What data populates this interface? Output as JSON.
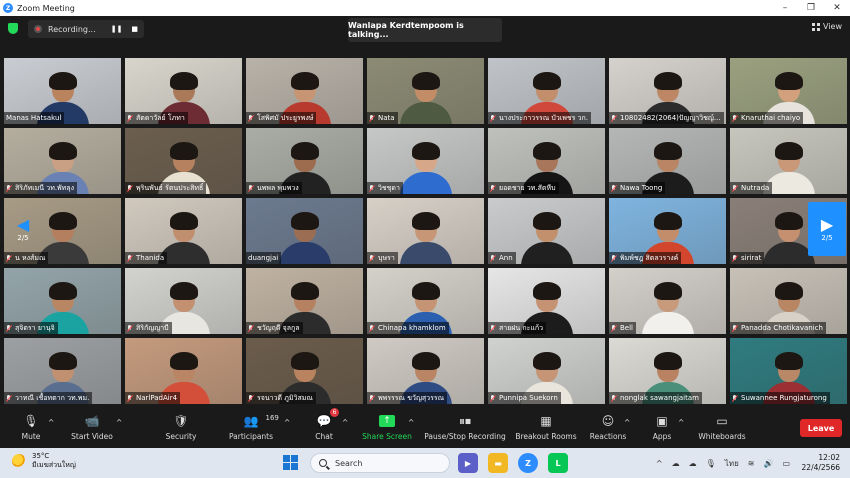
{
  "window": {
    "title": "Zoom Meeting",
    "controls": [
      "–",
      "❐",
      "✕"
    ]
  },
  "recording": {
    "label": "Recording...",
    "pause_icon": "pause-icon",
    "stop_icon": "stop-icon"
  },
  "talking_banner": "Wanlapa Kerdtempoom is talking...",
  "view": {
    "label": "View"
  },
  "pager": {
    "left_label": "2/5",
    "right_label": "2/5"
  },
  "participants": [
    {
      "name": "Manas Hatsakul",
      "muted": false,
      "bg": "#c9cdd2",
      "skin": "#b9835e",
      "shirt": "#233a66"
    },
    {
      "name": "สัตดาวัลย์ โภทา",
      "muted": true,
      "bg": "#d8d5cc",
      "skin": "#a9795a",
      "shirt": "#6d2b33"
    },
    {
      "name": "โสพิศมั ประยูรพงษ์",
      "muted": true,
      "bg": "#b8b2a8",
      "skin": "#c79574",
      "shirt": "#b83a2e"
    },
    {
      "name": "Nata",
      "muted": true,
      "bg": "#8c8b74",
      "skin": "#c28c67",
      "shirt": "#4f5a42"
    },
    {
      "name": "นางประกาวรรณ บัวเพชร วก.",
      "muted": true,
      "bg": "#c0c4c8",
      "skin": "#c38e6c",
      "shirt": "#d0473c"
    },
    {
      "name": "10802482(2064)ปัญญาวิชญ์...",
      "muted": true,
      "bg": "#d5d2cd",
      "skin": "#bd8766",
      "shirt": "#2c2c2c"
    },
    {
      "name": "Knaruthai chaiyo",
      "muted": true,
      "bg": "#9aa07f",
      "skin": "#d3a07d",
      "shirt": "#e7e2db"
    },
    {
      "name": "สิริภัทเมนี วท.พัทลุง",
      "muted": true,
      "bg": "#b5ae9f",
      "skin": "#caa085",
      "shirt": "#6a81b3"
    },
    {
      "name": "พุรินพันธ์ รัตนประสิทธิ์",
      "muted": true,
      "bg": "#6b5e4e",
      "skin": "#b5815f",
      "shirt": "#e8e0d0"
    },
    {
      "name": "นพพล พุมพวง",
      "muted": true,
      "bg": "#a9ada5",
      "skin": "#9d6b4d",
      "shirt": "#222222"
    },
    {
      "name": "วิชชุดา",
      "muted": true,
      "bg": "#c6c8c7",
      "skin": "#d6a789",
      "shirt": "#2f6ccf"
    },
    {
      "name": "ยอดชาย วท.สัตหีบ",
      "muted": true,
      "bg": "#bfc1bd",
      "skin": "#a8765a",
      "shirt": "#151515"
    },
    {
      "name": "Nawa Toong",
      "muted": true,
      "bg": "#b4b7b6",
      "skin": "#b98565",
      "shirt": "#1c1c1c"
    },
    {
      "name": "Nutrada",
      "muted": true,
      "bg": "#c7c6bd",
      "skin": "#c99878",
      "shirt": "#ece9e0"
    },
    {
      "name": "น หงส์มณ",
      "muted": true,
      "bg": "#a79b85",
      "skin": "#b47f5e",
      "shirt": "#3a3a3a"
    },
    {
      "name": "Thanida",
      "muted": true,
      "bg": "#d1c9be",
      "skin": "#c08f6f",
      "shirt": "#2e2e2e"
    },
    {
      "name": "duangjai",
      "muted": false,
      "bg": "#6c7a8f",
      "skin": "#9b6e54",
      "shirt": "#2a3c6a"
    },
    {
      "name": "บุษรา",
      "muted": true,
      "bg": "#d7d0c7",
      "skin": "#c79677",
      "shirt": "#3a4a6a"
    },
    {
      "name": "Ann",
      "muted": true,
      "bg": "#c9cbcc",
      "skin": "#c2906d",
      "shirt": "#202020"
    },
    {
      "name": "พิมพ์ชฎ สิตลวรางค์",
      "muted": true,
      "bg": "#7fb4df",
      "skin": "#c28d6b",
      "shirt": "#d3462e"
    },
    {
      "name": "sirirat",
      "muted": true,
      "bg": "#8a7f78",
      "skin": "#c4906f",
      "shirt": "#2c2c2c"
    },
    {
      "name": "สุจิตรา ยานุจิ",
      "muted": true,
      "bg": "#93a4a9",
      "skin": "#b98664",
      "shirt": "#1aa3a0"
    },
    {
      "name": "สิริกัญญาบี",
      "muted": true,
      "bg": "#d2d3cf",
      "skin": "#c39072",
      "shirt": "#e8e6e1"
    },
    {
      "name": "ชวัญฤดี จุลกูล",
      "muted": true,
      "bg": "#bfb2a2",
      "skin": "#b58161",
      "shirt": "#2c2c2c"
    },
    {
      "name": "Chinapa khamklom",
      "muted": true,
      "bg": "#d4d1c9",
      "skin": "#c59475",
      "shirt": "#2b5fb0"
    },
    {
      "name": "สายฝน กะแก้ว",
      "muted": true,
      "bg": "#e6e6e6",
      "skin": "#c59374",
      "shirt": "#1c1c1c"
    },
    {
      "name": "Bell",
      "muted": true,
      "bg": "#d3cfc9",
      "skin": "#c89a7c",
      "shirt": "#f2f0ec"
    },
    {
      "name": "Panadda Chotikavanich",
      "muted": true,
      "bg": "#c7c1b7",
      "skin": "#b98664",
      "shirt": "#d7d1c8"
    },
    {
      "name": "วาทณี เชื้อทตาก วท.พม.",
      "muted": true,
      "bg": "#9da0a3",
      "skin": "#c19070",
      "shirt": "#5a6f8f"
    },
    {
      "name": "NarlPadAir4",
      "muted": true,
      "bg": "#c49a7d",
      "skin": "#b98565",
      "shirt": "#d34f3a"
    },
    {
      "name": "รจนาวดี ภูมิวิสมณ",
      "muted": true,
      "bg": "#6b5c4b",
      "skin": "#b9835f",
      "shirt": "#2c2c2c"
    },
    {
      "name": "พพรรรณ ขวัญสุวรรณ",
      "muted": true,
      "bg": "#cfcac3",
      "skin": "#b98564",
      "shirt": "#2f4b83"
    },
    {
      "name": "Punnipa Suekorn",
      "muted": true,
      "bg": "#d0d2cf",
      "skin": "#c59575",
      "shirt": "#e9e4dc"
    },
    {
      "name": "nonglak sawangjaitam",
      "muted": true,
      "bg": "#dbdad4",
      "skin": "#b98262",
      "shirt": "#4a8f7a"
    },
    {
      "name": "Suwannee Rungjaturong",
      "muted": true,
      "bg": "#2f7b7f",
      "skin": "#b88867",
      "shirt": "#9c2f34"
    }
  ],
  "toolbar": {
    "mute": "Mute",
    "start_video": "Start Video",
    "security": "Security",
    "participants": "Participants",
    "participants_count": "169",
    "chat": "Chat",
    "chat_badge": "6",
    "share_screen": "Share Screen",
    "pause_recording": "Pause/Stop Recording",
    "breakout": "Breakout Rooms",
    "reactions": "Reactions",
    "apps": "Apps",
    "whiteboards": "Whiteboards",
    "leave": "Leave",
    "caret": "^"
  },
  "taskbar": {
    "temperature": "35°C",
    "weather_text": "มีเมฆส่วนใหญ่",
    "search_placeholder": "Search",
    "tray_lang": "ไทย",
    "time": "12:02",
    "date": "22/4/2566",
    "tray_caret": "^"
  },
  "colors": {
    "accent": "#2D8CFF",
    "green": "#23d959",
    "leave": "#e02828",
    "pager": "#1e90ff"
  }
}
